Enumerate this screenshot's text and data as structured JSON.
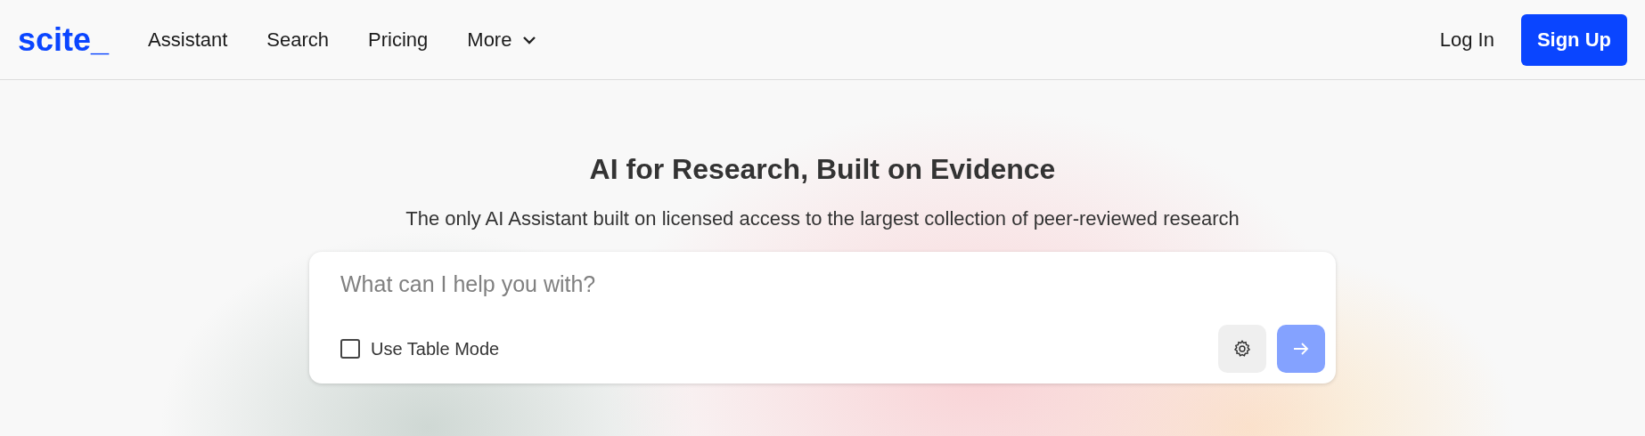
{
  "header": {
    "logo": "scite_",
    "nav": [
      {
        "label": "Assistant",
        "dropdown": false
      },
      {
        "label": "Search",
        "dropdown": false
      },
      {
        "label": "Pricing",
        "dropdown": false
      },
      {
        "label": "More",
        "dropdown": true
      }
    ],
    "login": "Log In",
    "signup": "Sign Up"
  },
  "hero": {
    "title": "AI for Research, Built on Evidence",
    "subtitle": "The only AI Assistant built on licensed access to the largest collection of peer-reviewed research"
  },
  "prompt": {
    "placeholder": "What can I help you with?",
    "table_mode": {
      "label": "Use Table Mode",
      "checked": false
    },
    "submit": {
      "disabled": true
    }
  }
}
